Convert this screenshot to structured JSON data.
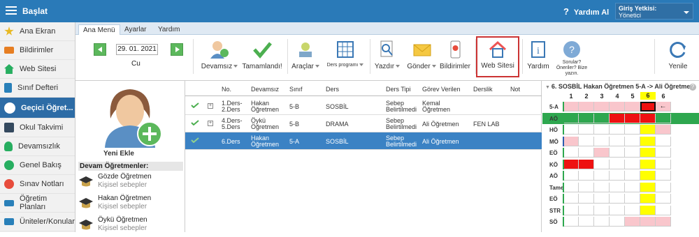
{
  "topbar": {
    "start": "Başlat",
    "help": "Yardım Al",
    "auth_title": "Giriş Yetkisi:",
    "auth_value": "Yönetici",
    "color": "#2a7ab8"
  },
  "sidebar": {
    "items": [
      {
        "label": "Ana Ekran",
        "icon": "star-icon",
        "color": "#e8b923"
      },
      {
        "label": "Bildirimler",
        "icon": "envelope-icon",
        "color": "#e67e22"
      },
      {
        "label": "Web Sitesi",
        "icon": "home-icon",
        "color": "#27ae60"
      },
      {
        "label": "Sınıf Defteri",
        "icon": "notebook-icon",
        "color": "#2980b9"
      },
      {
        "label": "Geçici Öğret...",
        "icon": "user-icon",
        "color": "#ffffff"
      },
      {
        "label": "Okul Takvimi",
        "icon": "calendar-icon",
        "color": "#34495e"
      },
      {
        "label": "Devamsızlık",
        "icon": "person-icon",
        "color": "#27ae60"
      },
      {
        "label": "Genel Bakış",
        "icon": "check-circle-icon",
        "color": "#27ae60"
      },
      {
        "label": "Sınav Notları",
        "icon": "grade-icon",
        "color": "#e74c3c"
      },
      {
        "label": "Öğretim Planları",
        "icon": "plan-icon",
        "color": "#2980b9"
      },
      {
        "label": "Üniteler/Konular",
        "icon": "units-icon",
        "color": "#2980b9"
      }
    ]
  },
  "tabs": [
    "Ana Menü",
    "Ayarlar",
    "Yardım"
  ],
  "ribbon": {
    "date": "29. 01. 2021",
    "day": "Cu",
    "buttons": {
      "devamsiz": "Devamsız",
      "tamamlandi": "Tamamlandı!",
      "araclar": "Araçlar",
      "ders_programi": "Ders programı",
      "yazdir": "Yazdır",
      "gonder": "Gönder",
      "bildirimler": "Bildirimler",
      "web_sitesi": "Web Sitesi",
      "yardim": "Yardım",
      "sorular_1": "Sorular?",
      "sorular_2": "Öneriler? Bize",
      "sorular_3": "yazın.",
      "yenile": "Yenile"
    }
  },
  "left": {
    "add": "Yeni Ekle",
    "header": "Devam Öğretmenler:",
    "teachers": [
      {
        "name": "Gözde Öğretmen",
        "sub": "Kişisel sebepler"
      },
      {
        "name": "Hakan Öğretmen",
        "sub": "Kişisel sebepler"
      },
      {
        "name": "Öykü Öğretmen",
        "sub": "Kişisel sebepler"
      }
    ]
  },
  "table": {
    "headers": [
      "No.",
      "Devamsız",
      "Sınıf",
      "Ders",
      "Ders Tipi",
      "Görev Verilen",
      "Derslik",
      "Not"
    ],
    "rows": [
      {
        "no_1": "1.Ders-",
        "no_2": "2.Ders",
        "dev_1": "Hakan",
        "dev_2": "Öğretmen",
        "sinif": "5-B",
        "ders": "SOSBİL",
        "tip_1": "Sebep",
        "tip_2": "Belirtilmedi",
        "gorev_1": "Kemal",
        "gorev_2": "Öğretmen",
        "derslik": "",
        "selected": false
      },
      {
        "no_1": "4.Ders-",
        "no_2": "5.Ders",
        "dev_1": "Öykü",
        "dev_2": "Öğretmen",
        "sinif": "5-B",
        "ders": "DRAMA",
        "tip_1": "Sebep",
        "tip_2": "Belirtilmedi",
        "gorev_1": "Ali Öğretmen",
        "gorev_2": "",
        "derslik": "FEN LAB",
        "selected": false
      },
      {
        "no_1": "6.Ders",
        "no_2": "",
        "dev_1": "Hakan",
        "dev_2": "Öğretmen",
        "sinif": "5-A",
        "ders": "SOSBİL",
        "tip_1": "Sebep",
        "tip_2": "Belirtilmedi",
        "gorev_1": "Ali Öğretmen",
        "gorev_2": "",
        "derslik": "",
        "selected": true
      }
    ]
  },
  "grid": {
    "title": "6. SOSBİL Hakan Öğretmen 5-A -> Ali Öğretmen",
    "columns": [
      "1",
      "2",
      "3",
      "4",
      "5",
      "6",
      "6"
    ],
    "rows": [
      {
        "label": "5-A",
        "cells": [
          "pink",
          "pink",
          "pink",
          "pink",
          "pink",
          "red",
          "arrow"
        ],
        "arrow": "←"
      },
      {
        "label": "AÖ",
        "cells": [
          "green",
          "green",
          "green",
          "red",
          "red",
          "red",
          "green"
        ]
      },
      {
        "label": "HÖ",
        "cells": [
          "",
          "",
          "",
          "",
          "",
          "yellow",
          "pink"
        ]
      },
      {
        "label": "MÖ",
        "cells": [
          "pink",
          "",
          "",
          "",
          "",
          "yellow",
          ""
        ]
      },
      {
        "label": "EÖ",
        "cells": [
          "",
          "",
          "pink",
          "",
          "",
          "yellow",
          ""
        ]
      },
      {
        "label": "KÖ",
        "cells": [
          "red",
          "red",
          "",
          "",
          "",
          "yellow",
          ""
        ]
      },
      {
        "label": "AÖ",
        "cells": [
          "",
          "",
          "",
          "",
          "",
          "yellow",
          ""
        ]
      },
      {
        "label": "Tamer",
        "cells": [
          "",
          "",
          "",
          "",
          "",
          "yellow",
          ""
        ]
      },
      {
        "label": "EÖ",
        "cells": [
          "",
          "",
          "",
          "",
          "",
          "yellow",
          ""
        ]
      },
      {
        "label": "STR",
        "cells": [
          "",
          "",
          "",
          "",
          "",
          "yellow",
          ""
        ]
      },
      {
        "label": "SÖ",
        "cells": [
          "",
          "",
          "",
          "",
          "pink",
          "pink",
          "pink"
        ]
      }
    ]
  }
}
